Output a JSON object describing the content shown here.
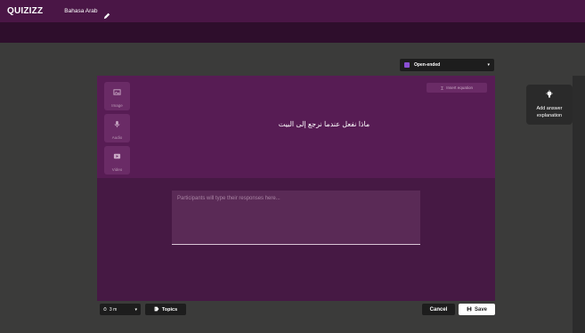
{
  "topbar": {
    "logo": "QUIZIZZ",
    "quiz_name": "Bahasa Arab"
  },
  "question_type": {
    "selected": "Open-ended"
  },
  "media": {
    "image_label": "Image",
    "audio_label": "Audio",
    "video_label": "Video"
  },
  "insert_equation_label": "Insert equation",
  "question_text": "ماذا نفعل عندما نرجع إلى البيت",
  "answer": {
    "placeholder": "Participants will type their responses here..."
  },
  "side_panel": {
    "label": "Add answer explanation"
  },
  "footer": {
    "time_value": "3 m",
    "topics_label": "Topics",
    "cancel_label": "Cancel",
    "save_label": "Save"
  },
  "colors": {
    "topbar": "#4a1646",
    "editor_question": "#571c54",
    "editor_answer": "#461944",
    "background": "#3b3b3a"
  }
}
